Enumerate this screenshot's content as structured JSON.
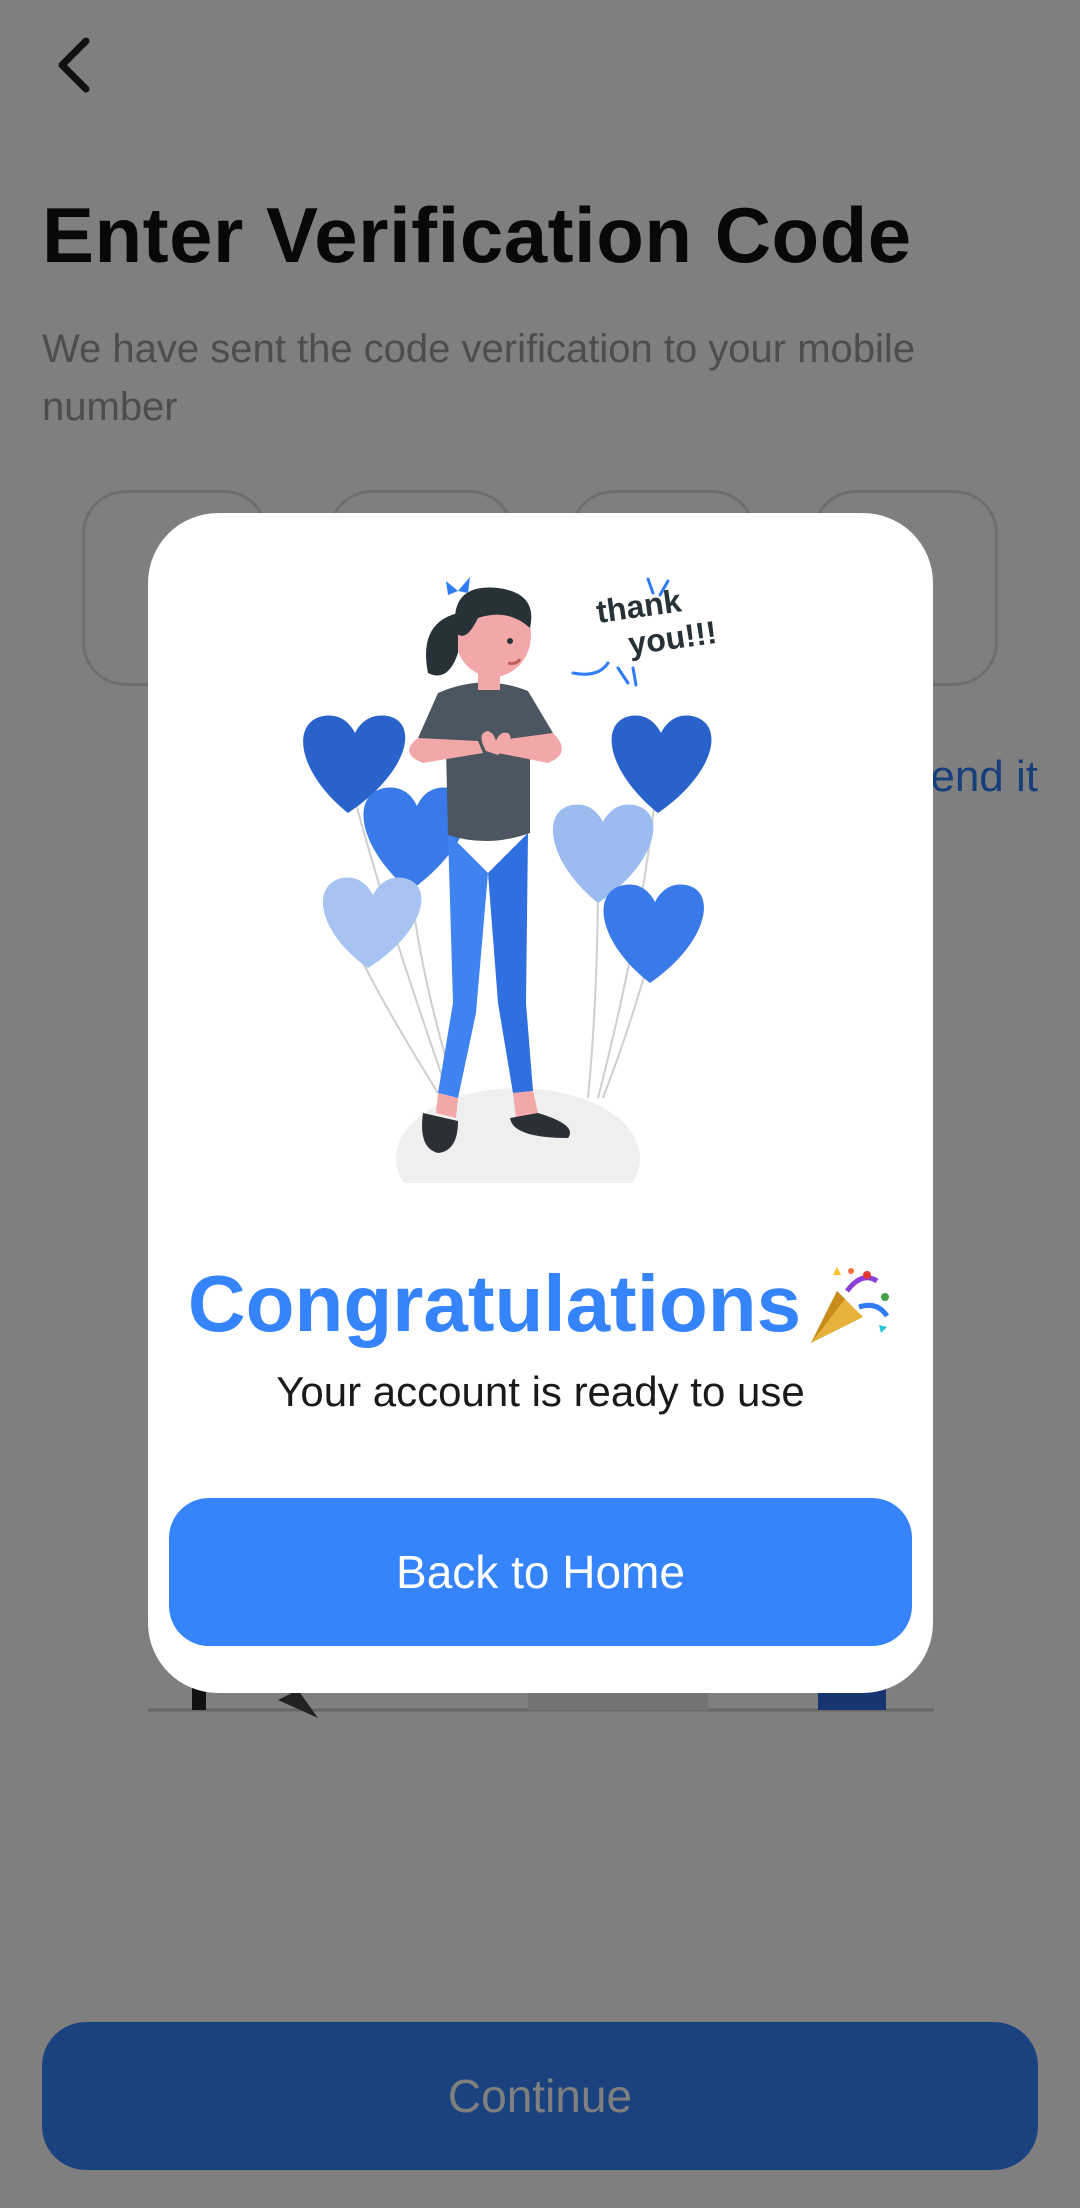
{
  "screen": {
    "title": "Enter Verification Code",
    "subtitle": "We have sent the code verification to your mobile number",
    "otp_digits": [
      "",
      "",
      "",
      ""
    ],
    "resend_text": "Resend it",
    "continue_label": "Continue"
  },
  "modal": {
    "illustration_text": "thank you!!!",
    "title": "Congratulations",
    "message": "Your account is ready to use",
    "button_label": "Back to Home"
  },
  "colors": {
    "accent": "#3584fc",
    "overlay": "rgba(0,0,0,0.5)",
    "title": "#111111",
    "subtitle": "#9a9a9a"
  },
  "icons": {
    "back": "chevron-left-icon",
    "party": "party-popper-icon"
  }
}
